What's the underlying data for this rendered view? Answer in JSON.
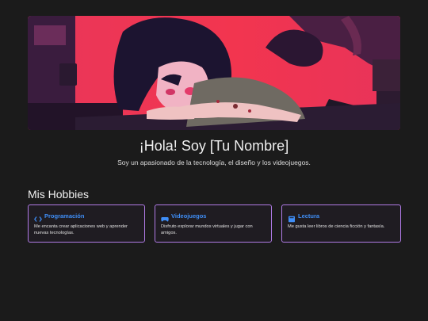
{
  "hero": {
    "banner_alt": "anime-girl-at-desk-illustration",
    "title": "¡Hola! Soy [Tu Nombre]",
    "subtitle": "Soy un apasionado de la tecnología, el diseño y los videojuegos."
  },
  "hobbies": {
    "title": "Mis Hobbies",
    "cards": [
      {
        "icon": "code-icon",
        "title": "Programación",
        "description": "Me encanta crear aplicaciones web y aprender nuevas tecnologías."
      },
      {
        "icon": "gamepad-icon",
        "title": "Videojuegos",
        "description": "Disfruto explorar mundos virtuales y jugar con amigos."
      },
      {
        "icon": "book-icon",
        "title": "Lectura",
        "description": "Me gusta leer libros de ciencia ficción y fantasía."
      }
    ]
  },
  "colors": {
    "background": "#1b1b1b",
    "accent_border": "#b07be6",
    "card_title": "#3f8ef7",
    "banner_red": "#ef3b57"
  }
}
